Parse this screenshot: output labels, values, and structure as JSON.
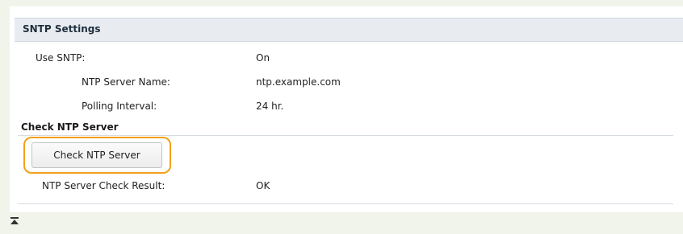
{
  "section": {
    "title": "SNTP Settings"
  },
  "rows": [
    {
      "label": "Use SNTP:",
      "value": "On"
    },
    {
      "label": "NTP Server Name:",
      "value": "ntp.example.com"
    },
    {
      "label": "Polling Interval:",
      "value": "24 hr."
    }
  ],
  "check": {
    "heading": "Check NTP Server",
    "button_label": "Check NTP Server",
    "result_label": "NTP Server Check Result:",
    "result_value": "OK"
  },
  "colors": {
    "highlight": "#f3a01a",
    "header_bg": "#e8ecf1",
    "page_bg": "#f1f4ea"
  },
  "icons": {
    "back_to_top": "back-to-top-icon"
  }
}
